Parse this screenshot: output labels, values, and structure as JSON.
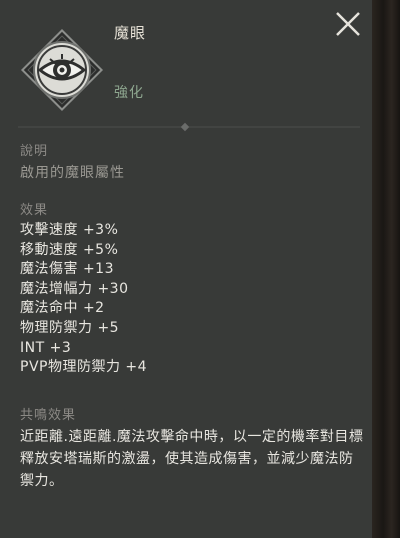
{
  "item": {
    "title": "魔眼",
    "subtitle": "強化",
    "icon": "eye-emblem-icon"
  },
  "close": {
    "icon": "close-icon"
  },
  "description": {
    "label": "說明",
    "text": "啟用的魔眼屬性"
  },
  "effects": {
    "label": "效果",
    "items": [
      "攻擊速度 +3%",
      "移動速度 +5%",
      "魔法傷害 +13",
      "魔法增幅力 +30",
      "魔法命中 +2",
      "物理防禦力 +5",
      "INT +3",
      "PVP物理防禦力 +4"
    ]
  },
  "resonance": {
    "label": "共鳴效果",
    "text": "近距離.遠距離.魔法攻擊命中時，以一定的機率對目標釋放安塔瑞斯的激盪，使其造成傷害，並減少魔法防禦力。"
  },
  "colors": {
    "panel": "#383a38",
    "subtitle": "#8ea68f",
    "label": "#8c8a86",
    "text": "#e8e6e0"
  }
}
